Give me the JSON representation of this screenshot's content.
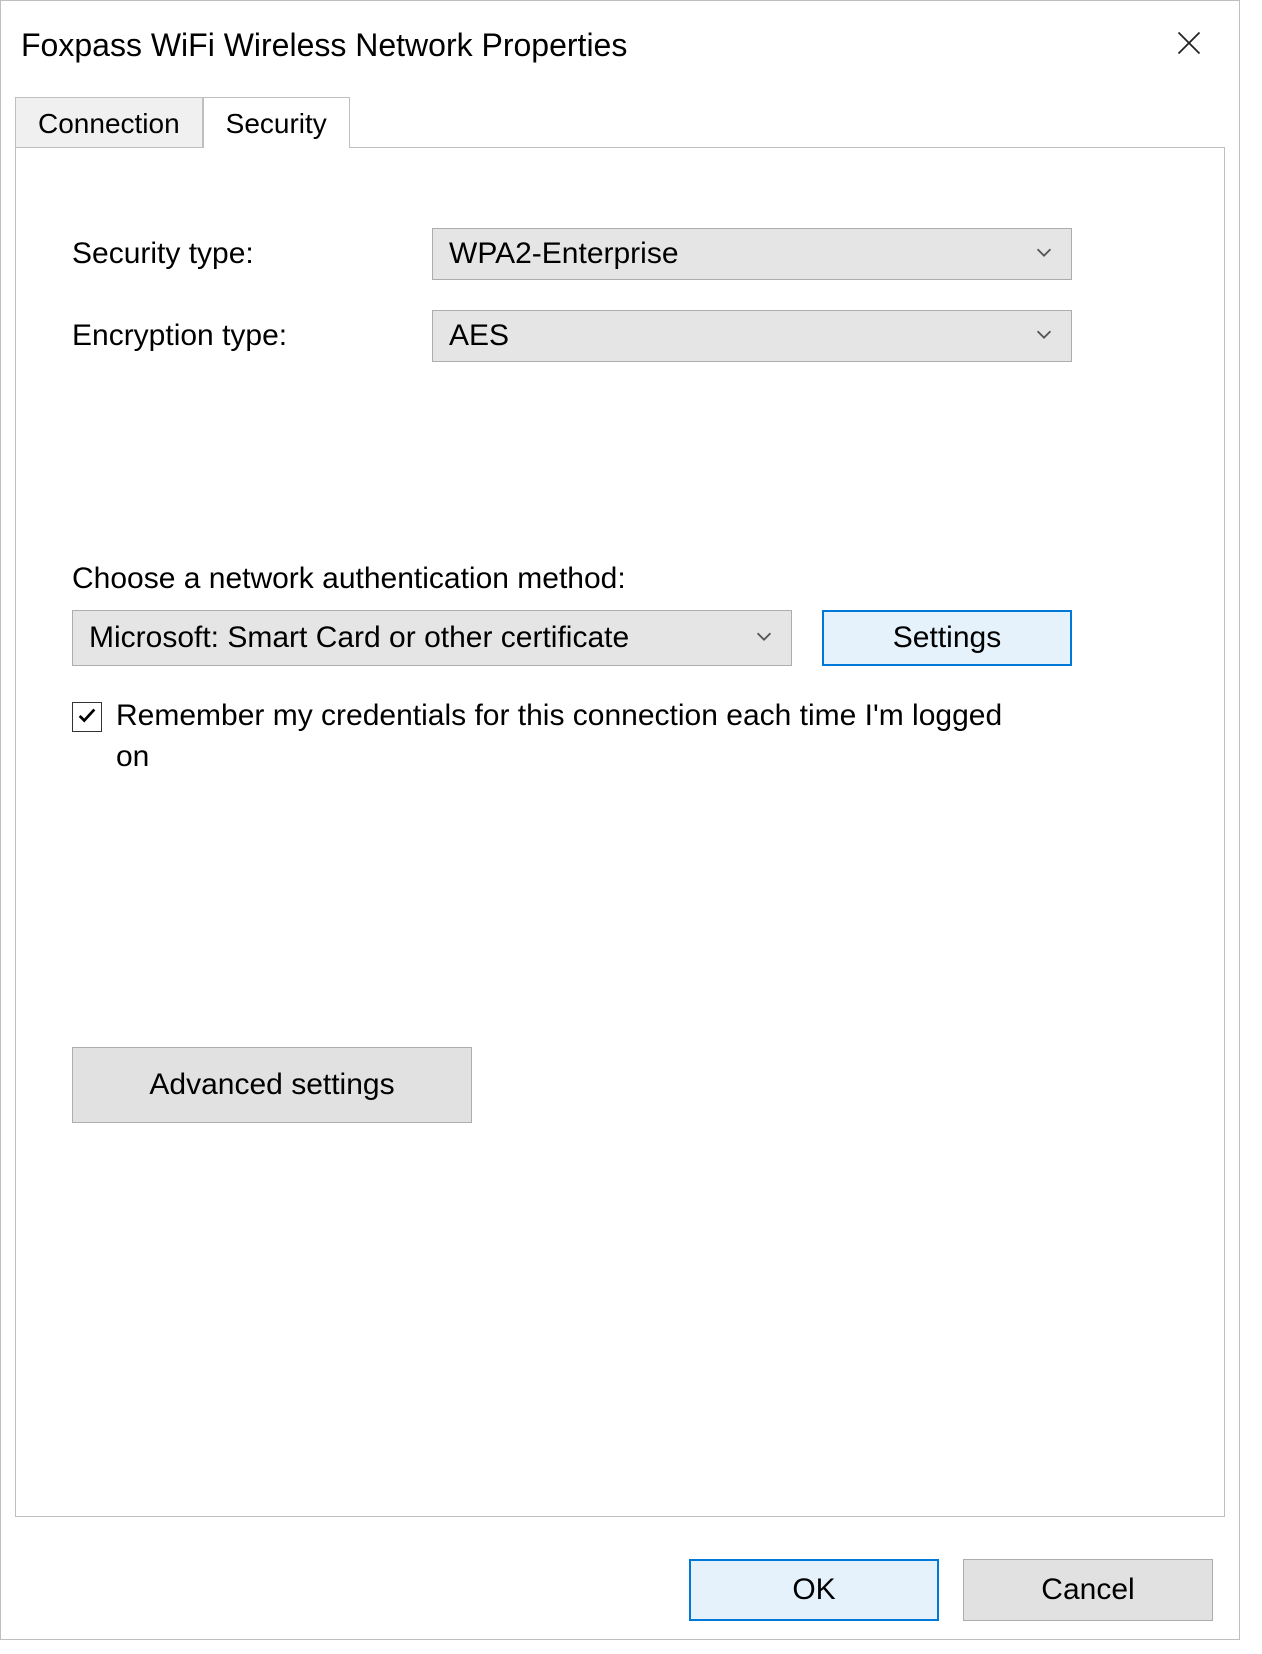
{
  "window": {
    "title": "Foxpass WiFi Wireless Network Properties"
  },
  "tabs": {
    "connection": "Connection",
    "security": "Security",
    "active": "security"
  },
  "security": {
    "security_type_label": "Security type:",
    "security_type_value": "WPA2-Enterprise",
    "encryption_type_label": "Encryption type:",
    "encryption_type_value": "AES",
    "auth_method_label": "Choose a network authentication method:",
    "auth_method_value": "Microsoft: Smart Card or other certificate",
    "settings_button": "Settings",
    "remember_credentials_checked": true,
    "remember_credentials_label": "Remember my credentials for this connection each time I'm logged on",
    "advanced_settings_button": "Advanced settings"
  },
  "buttons": {
    "ok": "OK",
    "cancel": "Cancel"
  }
}
